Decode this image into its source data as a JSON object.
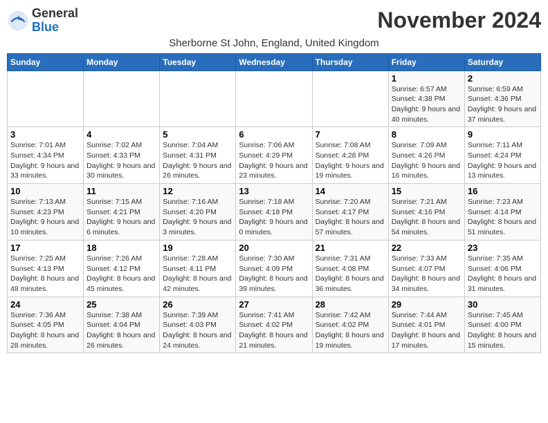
{
  "header": {
    "logo_line1": "General",
    "logo_line2": "Blue",
    "month_title": "November 2024",
    "subtitle": "Sherborne St John, England, United Kingdom"
  },
  "days_of_week": [
    "Sunday",
    "Monday",
    "Tuesday",
    "Wednesday",
    "Thursday",
    "Friday",
    "Saturday"
  ],
  "weeks": [
    [
      {
        "day": "",
        "info": ""
      },
      {
        "day": "",
        "info": ""
      },
      {
        "day": "",
        "info": ""
      },
      {
        "day": "",
        "info": ""
      },
      {
        "day": "",
        "info": ""
      },
      {
        "day": "1",
        "info": "Sunrise: 6:57 AM\nSunset: 4:38 PM\nDaylight: 9 hours and 40 minutes."
      },
      {
        "day": "2",
        "info": "Sunrise: 6:59 AM\nSunset: 4:36 PM\nDaylight: 9 hours and 37 minutes."
      }
    ],
    [
      {
        "day": "3",
        "info": "Sunrise: 7:01 AM\nSunset: 4:34 PM\nDaylight: 9 hours and 33 minutes."
      },
      {
        "day": "4",
        "info": "Sunrise: 7:02 AM\nSunset: 4:33 PM\nDaylight: 9 hours and 30 minutes."
      },
      {
        "day": "5",
        "info": "Sunrise: 7:04 AM\nSunset: 4:31 PM\nDaylight: 9 hours and 26 minutes."
      },
      {
        "day": "6",
        "info": "Sunrise: 7:06 AM\nSunset: 4:29 PM\nDaylight: 9 hours and 23 minutes."
      },
      {
        "day": "7",
        "info": "Sunrise: 7:08 AM\nSunset: 4:28 PM\nDaylight: 9 hours and 19 minutes."
      },
      {
        "day": "8",
        "info": "Sunrise: 7:09 AM\nSunset: 4:26 PM\nDaylight: 9 hours and 16 minutes."
      },
      {
        "day": "9",
        "info": "Sunrise: 7:11 AM\nSunset: 4:24 PM\nDaylight: 9 hours and 13 minutes."
      }
    ],
    [
      {
        "day": "10",
        "info": "Sunrise: 7:13 AM\nSunset: 4:23 PM\nDaylight: 9 hours and 10 minutes."
      },
      {
        "day": "11",
        "info": "Sunrise: 7:15 AM\nSunset: 4:21 PM\nDaylight: 9 hours and 6 minutes."
      },
      {
        "day": "12",
        "info": "Sunrise: 7:16 AM\nSunset: 4:20 PM\nDaylight: 9 hours and 3 minutes."
      },
      {
        "day": "13",
        "info": "Sunrise: 7:18 AM\nSunset: 4:18 PM\nDaylight: 9 hours and 0 minutes."
      },
      {
        "day": "14",
        "info": "Sunrise: 7:20 AM\nSunset: 4:17 PM\nDaylight: 8 hours and 57 minutes."
      },
      {
        "day": "15",
        "info": "Sunrise: 7:21 AM\nSunset: 4:16 PM\nDaylight: 8 hours and 54 minutes."
      },
      {
        "day": "16",
        "info": "Sunrise: 7:23 AM\nSunset: 4:14 PM\nDaylight: 8 hours and 51 minutes."
      }
    ],
    [
      {
        "day": "17",
        "info": "Sunrise: 7:25 AM\nSunset: 4:13 PM\nDaylight: 8 hours and 48 minutes."
      },
      {
        "day": "18",
        "info": "Sunrise: 7:26 AM\nSunset: 4:12 PM\nDaylight: 8 hours and 45 minutes."
      },
      {
        "day": "19",
        "info": "Sunrise: 7:28 AM\nSunset: 4:11 PM\nDaylight: 8 hours and 42 minutes."
      },
      {
        "day": "20",
        "info": "Sunrise: 7:30 AM\nSunset: 4:09 PM\nDaylight: 8 hours and 39 minutes."
      },
      {
        "day": "21",
        "info": "Sunrise: 7:31 AM\nSunset: 4:08 PM\nDaylight: 8 hours and 36 minutes."
      },
      {
        "day": "22",
        "info": "Sunrise: 7:33 AM\nSunset: 4:07 PM\nDaylight: 8 hours and 34 minutes."
      },
      {
        "day": "23",
        "info": "Sunrise: 7:35 AM\nSunset: 4:06 PM\nDaylight: 8 hours and 31 minutes."
      }
    ],
    [
      {
        "day": "24",
        "info": "Sunrise: 7:36 AM\nSunset: 4:05 PM\nDaylight: 8 hours and 28 minutes."
      },
      {
        "day": "25",
        "info": "Sunrise: 7:38 AM\nSunset: 4:04 PM\nDaylight: 8 hours and 26 minutes."
      },
      {
        "day": "26",
        "info": "Sunrise: 7:39 AM\nSunset: 4:03 PM\nDaylight: 8 hours and 24 minutes."
      },
      {
        "day": "27",
        "info": "Sunrise: 7:41 AM\nSunset: 4:02 PM\nDaylight: 8 hours and 21 minutes."
      },
      {
        "day": "28",
        "info": "Sunrise: 7:42 AM\nSunset: 4:02 PM\nDaylight: 8 hours and 19 minutes."
      },
      {
        "day": "29",
        "info": "Sunrise: 7:44 AM\nSunset: 4:01 PM\nDaylight: 8 hours and 17 minutes."
      },
      {
        "day": "30",
        "info": "Sunrise: 7:45 AM\nSunset: 4:00 PM\nDaylight: 8 hours and 15 minutes."
      }
    ]
  ]
}
